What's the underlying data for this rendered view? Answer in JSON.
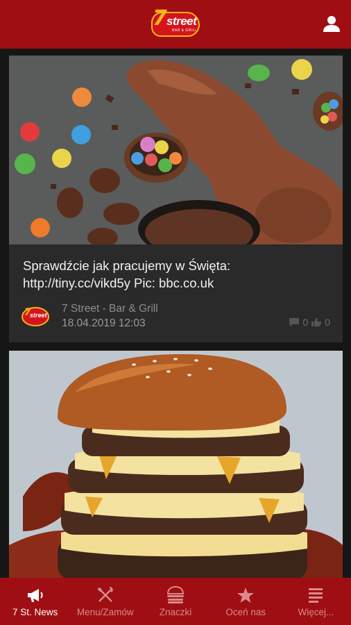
{
  "header": {
    "logo_seven": "7",
    "logo_word": "street",
    "logo_sub": "BAR & GRILL"
  },
  "posts": [
    {
      "text": "Sprawdźcie jak pracujemy w Święta:\nhttp://tiny.cc/vikd5y Pic: bbc.co.uk",
      "author": "7 Street - Bar & Grill",
      "date": "18.04.2019 12:03",
      "comments": "0",
      "likes": "0"
    }
  ],
  "nav": [
    {
      "label": "7 St. News",
      "icon": "megaphone-icon",
      "active": true
    },
    {
      "label": "Menu/Zamów",
      "icon": "fork-knife-icon",
      "active": false
    },
    {
      "label": "Znaczki",
      "icon": "burger-icon",
      "active": false
    },
    {
      "label": "Oceń nas",
      "icon": "star-icon",
      "active": false
    },
    {
      "label": "Więcej...",
      "icon": "menu-lines-icon",
      "active": false
    }
  ],
  "colors": {
    "brand_red": "#9f0e12",
    "card_bg": "#2a2a2a",
    "logo_yellow": "#f3b41b"
  }
}
